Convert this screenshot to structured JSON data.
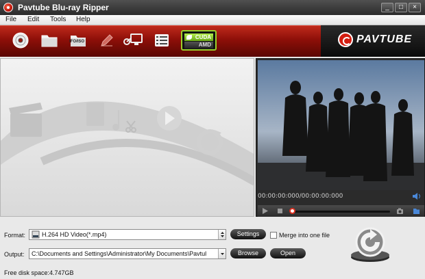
{
  "window": {
    "title": "Pavtube Blu-ray Ripper",
    "minimize": "_",
    "maximize": "□",
    "close": "×"
  },
  "menu": [
    "File",
    "Edit",
    "Tools",
    "Help"
  ],
  "toolbar": {
    "ifo_iso_label": "IFO/ISO",
    "cuda_label": "CUDA",
    "amd_label": "AMD",
    "brand": "PAVTUBE"
  },
  "player": {
    "timecode": "00:00:00:000/00:00:00:000"
  },
  "format": {
    "label": "Format:",
    "value": "H.264 HD Video(*.mp4)",
    "settings_label": "Settings",
    "merge_label": "Merge into one file",
    "merge_checked": false
  },
  "output": {
    "label": "Output:",
    "value": "C:\\Documents and Settings\\Administrator\\My Documents\\Pavtul",
    "browse_label": "Browse",
    "open_label": "Open"
  },
  "status": {
    "free_space": "Free disk space:4.747GB"
  },
  "colors": {
    "toolbar_red": "#a01a0f",
    "accent_green": "#9ad02c",
    "seek_red": "#e03020"
  }
}
